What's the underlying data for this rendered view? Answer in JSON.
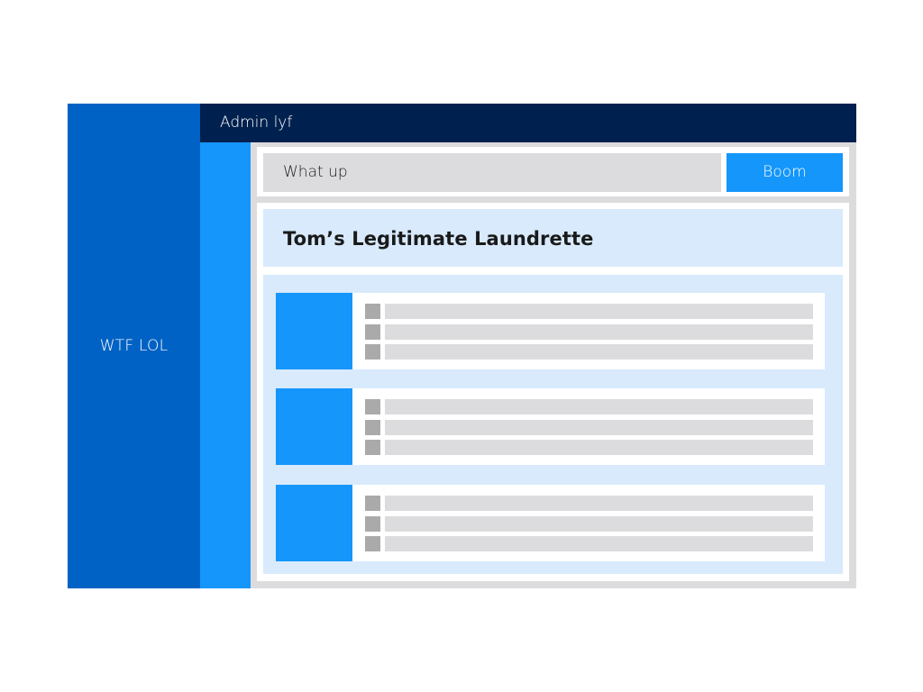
{
  "sidebar": {
    "label": "WTF LOL",
    "color": "#0062c4"
  },
  "topbar": {
    "title": "Admin lyf",
    "color": "#00214f"
  },
  "toolbar": {
    "search_value": "What up",
    "button_label": "Boom",
    "button_color": "#1596fb"
  },
  "main": {
    "title": "Tom’s Legitimate Laundrette",
    "items": [
      {
        "lines": 3
      },
      {
        "lines": 3
      },
      {
        "lines": 3
      }
    ]
  },
  "colors": {
    "accent": "#1596fb",
    "panel_tint": "#d8eafc",
    "placeholder_gray": "#dcdcde",
    "bullet_gray": "#aaaaaa"
  }
}
